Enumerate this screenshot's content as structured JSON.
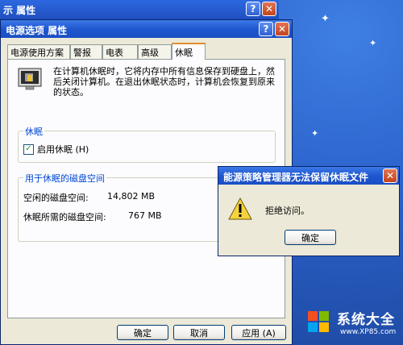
{
  "back_window": {
    "title": "示 属性"
  },
  "dialog": {
    "title": "电源选项 属性",
    "tabs": [
      "电源使用方案",
      "警报",
      "电表",
      "高级",
      "休眠"
    ],
    "active_tab": "休眠",
    "description": "在计算机休眠时，它将内存中所有信息保存到硬盘上，然后关闭计算机。在退出休眠状态时，计算机会恢复到原来的状态。",
    "hibernate_group": {
      "title": "休眠",
      "checkbox_label": "启用休眠 (H)",
      "checked": true
    },
    "disk_group": {
      "title": "用于休眠的磁盘空间",
      "free_label": "空闲的磁盘空间:",
      "free_value": "14,802 MB",
      "required_label": "休眠所需的磁盘空间:",
      "required_value": "767 MB"
    },
    "buttons": {
      "ok": "确定",
      "cancel": "取消",
      "apply": "应用 (A)"
    }
  },
  "messagebox": {
    "title": "能源策略管理器无法保留休眠文件",
    "message": "拒绝访问。",
    "ok": "确定"
  },
  "titlebar_buttons": {
    "help": "?",
    "close": "✕"
  },
  "watermark": {
    "text": "系统大全",
    "url": "www.XP85.com"
  }
}
